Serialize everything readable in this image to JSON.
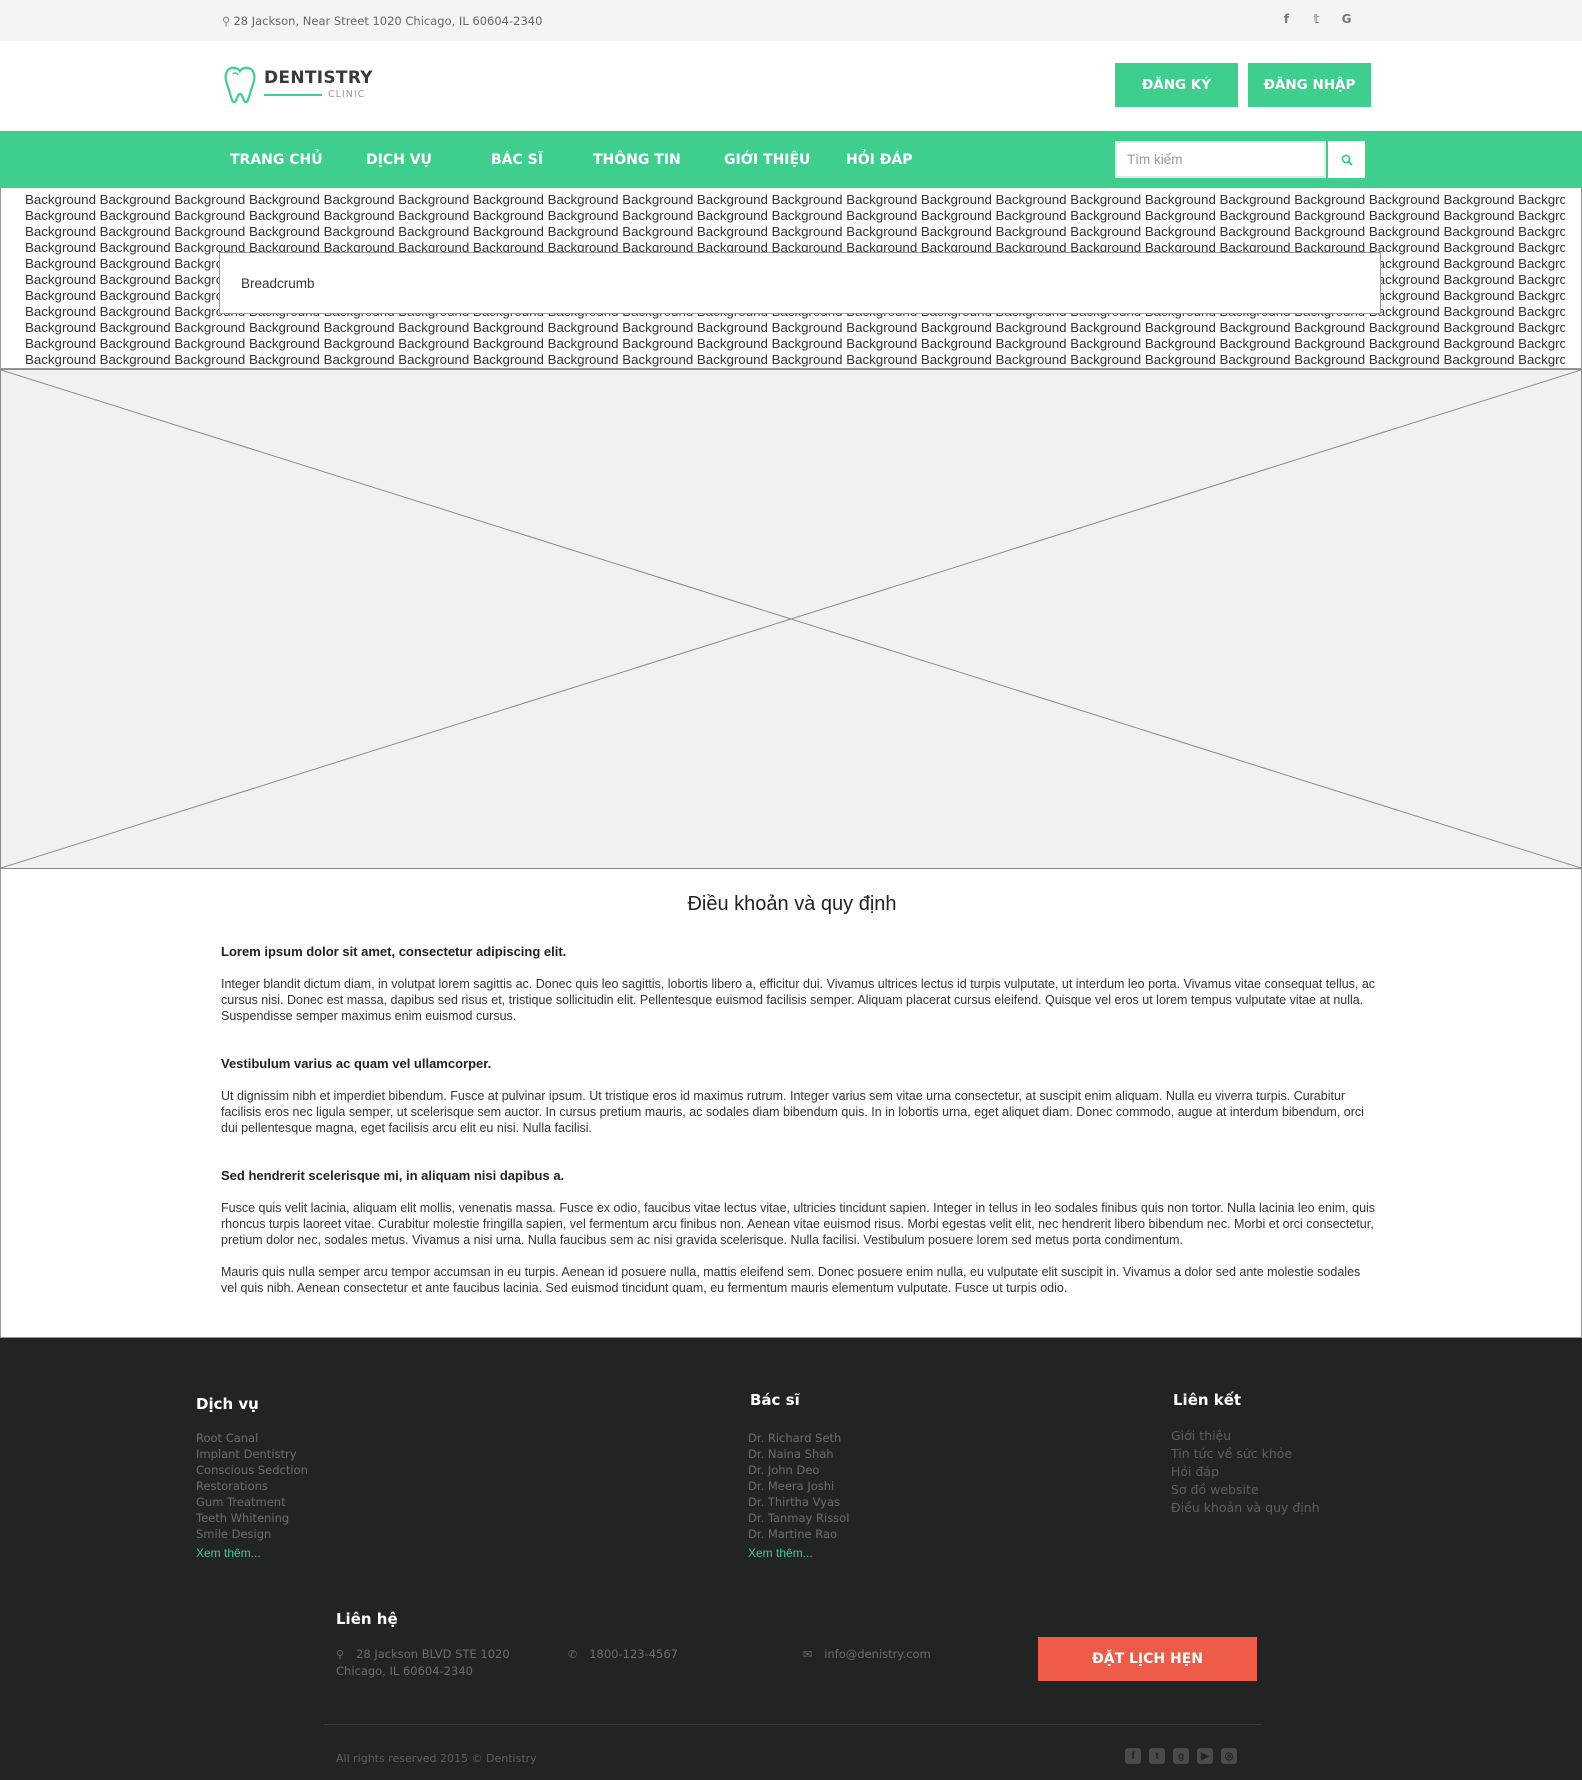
{
  "topbar": {
    "address": "28 Jackson, Near Street 1020 Chicago, IL 60604-2340",
    "social": [
      {
        "icon": "facebook-icon",
        "glyph": "f"
      },
      {
        "icon": "twitter-icon",
        "glyph": "t"
      },
      {
        "icon": "google-icon",
        "glyph": "G"
      }
    ]
  },
  "header": {
    "brand": "DENTISTRY",
    "brand_sub": "CLINIC",
    "register_label": "ĐĂNG KÝ",
    "login_label": "ĐĂNG NHẬP"
  },
  "nav": {
    "items": [
      "TRANG CHỦ",
      "DỊCH VỤ",
      "BÁC SĨ",
      "THÔNG TIN",
      "GIỚI THIỆU",
      "HỎI ĐÁP"
    ],
    "search_placeholder": "Tìm kiếm"
  },
  "banner": {
    "background_word": "Background",
    "breadcrumb": "Breadcrumb"
  },
  "content": {
    "title": "Điều khoản và quy định",
    "sections": [
      {
        "heading": "Lorem ipsum dolor sit amet, consectetur adipiscing elit.",
        "paragraphs": [
          "Integer blandit dictum diam, in volutpat lorem sagittis ac. Donec quis leo sagittis, lobortis libero a, efficitur dui. Vivamus ultrices lectus id turpis vulputate, ut interdum leo porta. Vivamus vitae consequat tellus, ac cursus nisi. Donec est massa, dapibus sed risus et, tristique sollicitudin elit. Pellentesque euismod facilisis semper. Aliquam placerat cursus eleifend. Quisque vel eros ut lorem tempus vulputate vitae at nulla. Suspendisse semper maximus enim euismod cursus."
        ]
      },
      {
        "heading": "Vestibulum varius ac quam vel ullamcorper.",
        "paragraphs": [
          "Ut dignissim nibh et imperdiet bibendum. Fusce at pulvinar ipsum. Ut tristique eros id maximus rutrum. Integer varius sem vitae urna consectetur, at suscipit enim aliquam. Nulla eu viverra turpis. Curabitur facilisis eros nec ligula semper, ut scelerisque sem auctor. In cursus pretium mauris, ac sodales diam bibendum quis. In in lobortis urna, eget aliquet diam. Donec commodo, augue at interdum bibendum, orci dui pellentesque magna, eget facilisis arcu elit eu nisi. Nulla facilisi."
        ]
      },
      {
        "heading": "Sed hendrerit scelerisque mi, in aliquam nisi dapibus a.",
        "paragraphs": [
          "Fusce quis velit lacinia, aliquam elit mollis, venenatis massa. Fusce ex odio, faucibus vitae lectus vitae, ultricies tincidunt sapien. Integer in tellus in leo sodales finibus quis non tortor. Nulla lacinia leo enim, quis rhoncus turpis laoreet vitae. Curabitur molestie fringilla sapien, vel fermentum arcu finibus non. Aenean vitae euismod risus. Morbi egestas velit elit, nec hendrerit libero bibendum nec. Morbi et orci consectetur, pretium dolor nec, sodales metus. Vivamus a nisi urna. Nulla faucibus sem ac nisi gravida scelerisque. Nulla facilisi. Vestibulum posuere lorem sed metus porta condimentum.",
          "Mauris quis nulla semper arcu tempor accumsan in eu turpis. Aenean id posuere nulla, mattis eleifend sem. Donec posuere enim nulla, eu vulputate elit suscipit in. Vivamus a dolor sed ante molestie sodales vel quis nibh. Aenean consectetur et ante faucibus lacinia. Sed euismod tincidunt quam, eu fermentum mauris elementum vulputate. Fusce ut turpis odio."
        ]
      }
    ]
  },
  "footer": {
    "services": {
      "title": "Dịch vụ",
      "items": [
        "Root Canal",
        "Implant Dentistry",
        "Conscious Sedction",
        "Restorations",
        "Gum Treatment",
        "Teeth Whitening",
        "Smile Design"
      ],
      "more": "Xem thêm..."
    },
    "doctors": {
      "title": "Bác sĩ",
      "items": [
        "Dr. Richard Seth",
        "Dr. Naina Shah",
        "Dr. John Deo",
        "Dr. Meera Joshi",
        "Dr. Thirtha Vyas",
        "Dr. Tanmay Rissol",
        "Dr. Martine Rao"
      ],
      "more": "Xem thêm..."
    },
    "links": {
      "title": "Liên kết",
      "items": [
        "Giới thiệu",
        "Tin tức về sức khỏe",
        "Hỏi đáp",
        "Sơ đồ website",
        "Điều khoản và quy định"
      ]
    },
    "contact": {
      "title": "Liên hệ",
      "address_line1": "28 Jackson BLVD STE 1020",
      "address_line2": "Chicago, IL 60604-2340",
      "phone": "1800-123-4567",
      "email": "info@denistry.com"
    },
    "appointment_label": "ĐẶT LỊCH HẸN",
    "copyright": "All rights reserved 2015 © Dentistry",
    "social_icons": [
      "facebook-square-icon",
      "twitter-square-icon",
      "google-plus-square-icon",
      "youtube-square-icon",
      "instagram-icon"
    ]
  },
  "colors": {
    "accent": "#3ecf8e",
    "appointment": "#ee5c47",
    "footer_bg": "#222323"
  }
}
